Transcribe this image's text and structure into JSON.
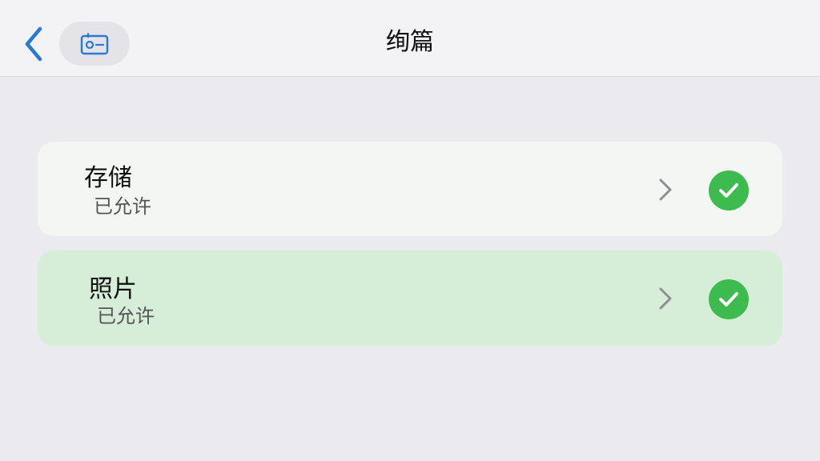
{
  "header": {
    "title": "绚篇",
    "back_icon": "chevron-left-icon",
    "pill_icon": "id-card-icon",
    "accent_color": "#2a7ad5"
  },
  "permissions": [
    {
      "label": "存储",
      "status": "已允许",
      "icon": "check-circle-icon",
      "highlighted": false
    },
    {
      "label": "照片",
      "status": "已允许",
      "icon": "check-circle-icon",
      "highlighted": true
    }
  ],
  "colors": {
    "check_green": "#3dbb4f",
    "highlight_row": "#d6eed7"
  }
}
